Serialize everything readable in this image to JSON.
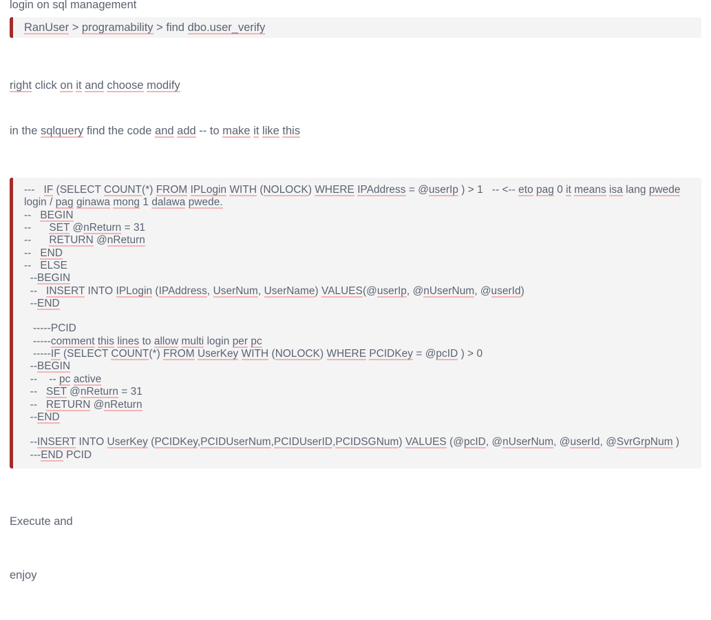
{
  "document": {
    "intro_line": "login on sql management",
    "callout": {
      "breadcrumb": "RanUser > programability > find dbo.user_verify",
      "accent_color": "#a52a2a",
      "background_color": "#f4f4f5"
    },
    "instructions": [
      "right click on it and choose modify",
      "in the sqlquery find the code and add -- to make it like this"
    ],
    "code": {
      "accent_color": "#a52a2a",
      "background_color": "#f4f4f5",
      "lines": [
        "---   IF (SELECT COUNT(*) FROM IPLogin WITH (NOLOCK) WHERE IPAddress = @userIp ) > 1   -- <-- eto pag 0 it means isa lang pwede login / pag ginawa mong 1 dalawa pwede.",
        "--   BEGIN",
        "--      SET @nReturn = 31",
        "--      RETURN @nReturn",
        "--   END",
        "--   ELSE",
        "  --BEGIN",
        "  --   INSERT INTO IPLogin (IPAddress, UserNum, UserName) VALUES(@userIp, @nUserNum, @userId)",
        "  --END",
        "",
        "   -----PCID",
        "   -----comment this lines to allow multi login per pc",
        "   -----IF (SELECT COUNT(*) FROM UserKey WITH (NOLOCK) WHERE PCIDKey = @pcID ) > 0",
        "  --BEGIN",
        "  --    -- pc active",
        "  --   SET @nReturn = 31",
        "  --   RETURN @nReturn",
        "  --END",
        "",
        "  --INSERT INTO UserKey (PCIDKey,PCIDUserNum,PCIDUserID,PCIDSGNum) VALUES (@pcID, @nUserNum, @userId, @SvrGrpNum )",
        "  ---END PCID"
      ]
    },
    "closing": [
      "Execute and",
      "enjoy"
    ]
  },
  "spellcheck": {
    "marker_color": "#f4b4b4",
    "intro_line_words": [],
    "callout_words": [
      "RanUser",
      "programability",
      "dbo.user",
      "verify"
    ],
    "instruction_words": [
      [
        "right",
        "on",
        "it",
        "and",
        "choose",
        "modify"
      ],
      [
        "sqlquery",
        "and",
        "add",
        "make",
        "it",
        "like",
        "this"
      ]
    ]
  }
}
